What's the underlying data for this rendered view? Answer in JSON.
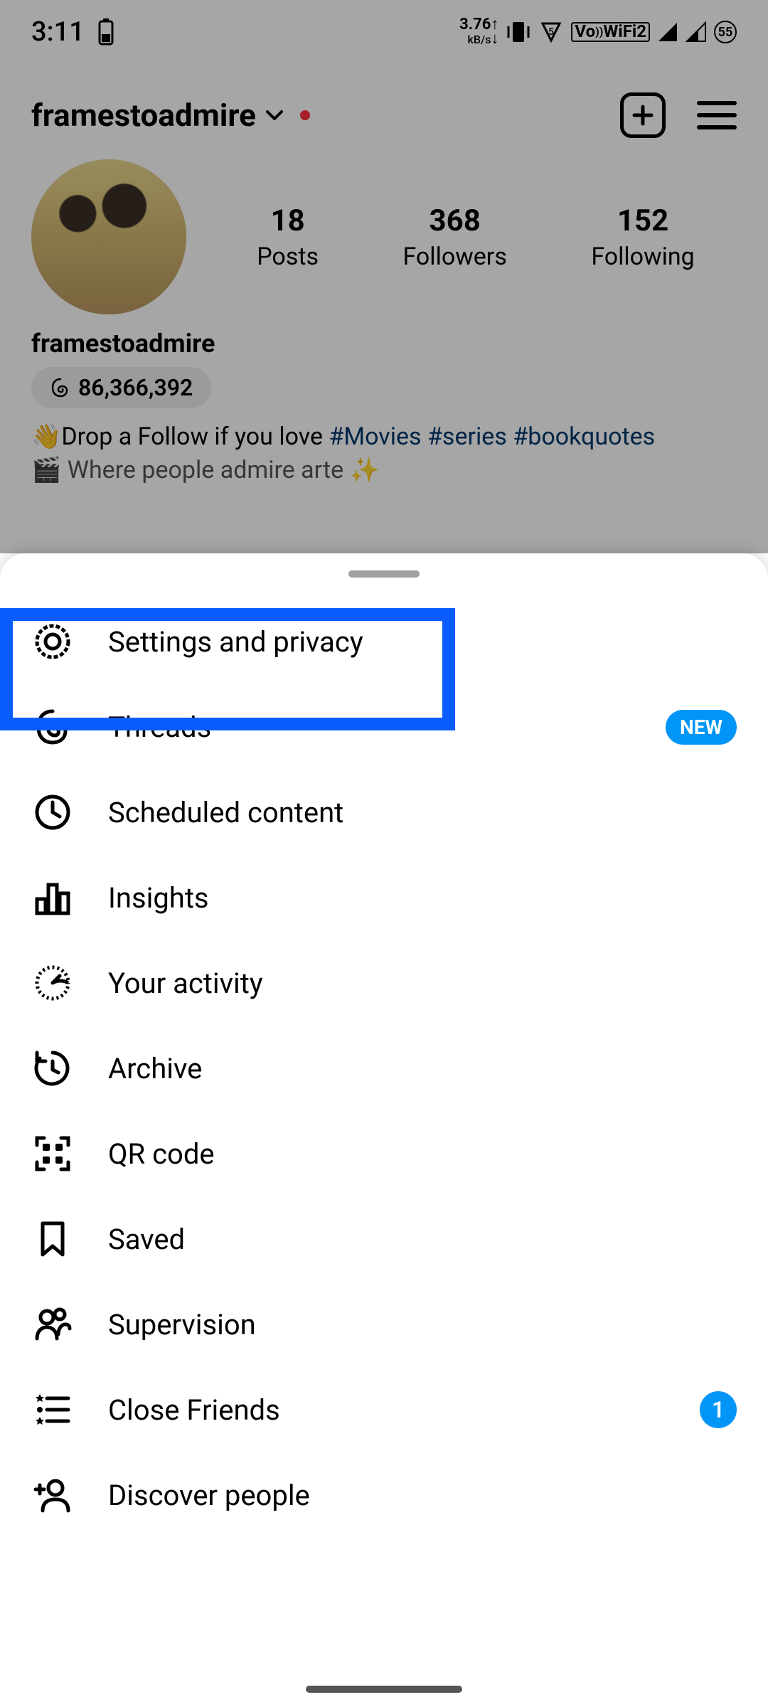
{
  "status_bar": {
    "time": "3:11",
    "net_speed": "3.76",
    "net_unit": "kB/s",
    "wifi_label": "WiFi",
    "vo_label": "Vo",
    "signal_num": "2",
    "battery_pct": "55"
  },
  "profile": {
    "username": "framestoadmire",
    "display_name": "framestoadmire",
    "stats": {
      "posts_num": "18",
      "posts_label": "Posts",
      "followers_num": "368",
      "followers_label": "Followers",
      "following_num": "152",
      "following_label": "Following"
    },
    "threads_count": "86,366,392",
    "bio_prefix": "👋Drop a Follow if you love ",
    "bio_tags": [
      "#Movies",
      "#series",
      "#bookquotes"
    ],
    "bio_line2_cut": "Where people admire arte"
  },
  "menu": {
    "items": [
      {
        "icon": "gear-icon",
        "label": "Settings and privacy"
      },
      {
        "icon": "threads-icon",
        "label": "Threads",
        "badge_new": "NEW"
      },
      {
        "icon": "clock-icon",
        "label": "Scheduled content"
      },
      {
        "icon": "insights-icon",
        "label": "Insights"
      },
      {
        "icon": "activity-icon",
        "label": "Your activity"
      },
      {
        "icon": "archive-icon",
        "label": "Archive"
      },
      {
        "icon": "qr-icon",
        "label": "QR code"
      },
      {
        "icon": "bookmark-icon",
        "label": "Saved"
      },
      {
        "icon": "supervision-icon",
        "label": "Supervision"
      },
      {
        "icon": "closefriends-icon",
        "label": "Close Friends",
        "count": "1"
      },
      {
        "icon": "discover-icon",
        "label": "Discover people"
      }
    ]
  }
}
